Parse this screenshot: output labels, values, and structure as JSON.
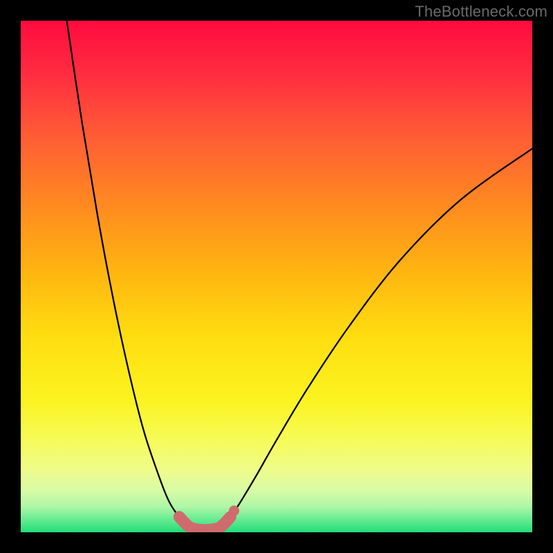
{
  "watermark": "TheBottleneck.com",
  "chart_data": {
    "type": "line",
    "title": "",
    "xlabel": "",
    "ylabel": "",
    "xlim": [
      0,
      100
    ],
    "ylim": [
      0,
      100
    ],
    "grid": false,
    "legend": null,
    "annotations": [],
    "series": [
      {
        "name": "curve-left",
        "x": [
          9,
          12,
          15,
          18,
          21,
          24,
          27,
          29,
          31,
          33
        ],
        "y": [
          100,
          80,
          62,
          46,
          32,
          20,
          11,
          6,
          3,
          1
        ]
      },
      {
        "name": "curve-right",
        "x": [
          39,
          41,
          43,
          46,
          50,
          56,
          64,
          74,
          86,
          100
        ],
        "y": [
          1,
          3,
          6,
          11,
          18,
          28,
          40,
          53,
          65,
          75
        ]
      },
      {
        "name": "flat-bottom-region",
        "x": [
          31,
          33,
          35,
          37,
          39,
          41
        ],
        "y": [
          3,
          1,
          0.5,
          0.5,
          1,
          3
        ],
        "style": "thick-pink-dots"
      }
    ],
    "background_gradient": {
      "stops": [
        {
          "pos": 0.0,
          "color": "#ff0b3e"
        },
        {
          "pos": 0.1,
          "color": "#ff2b40"
        },
        {
          "pos": 0.22,
          "color": "#ff5a36"
        },
        {
          "pos": 0.36,
          "color": "#ff8a20"
        },
        {
          "pos": 0.5,
          "color": "#ffb810"
        },
        {
          "pos": 0.62,
          "color": "#ffde10"
        },
        {
          "pos": 0.74,
          "color": "#fbf320"
        },
        {
          "pos": 0.82,
          "color": "#f6fb58"
        },
        {
          "pos": 0.88,
          "color": "#eefc8c"
        },
        {
          "pos": 0.92,
          "color": "#d6fba6"
        },
        {
          "pos": 0.95,
          "color": "#aef7a6"
        },
        {
          "pos": 0.975,
          "color": "#66eb92"
        },
        {
          "pos": 1.0,
          "color": "#22dd7a"
        }
      ]
    },
    "marker_color": "#cf6b6d",
    "curve_color": "#000000"
  }
}
